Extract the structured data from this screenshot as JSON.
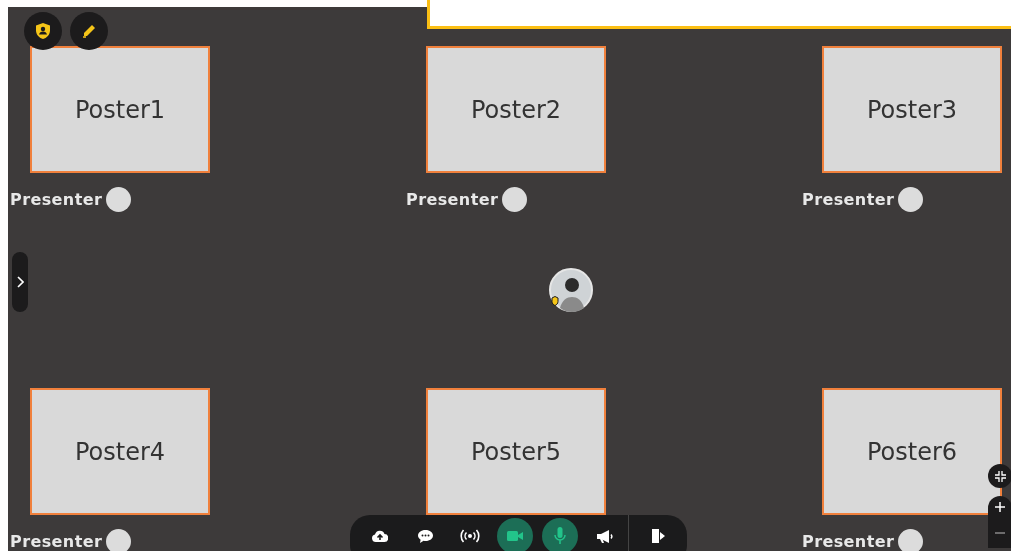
{
  "posters": [
    {
      "title": "Poster1",
      "presenter": "Presenter"
    },
    {
      "title": "Poster2",
      "presenter": "Presenter"
    },
    {
      "title": "Poster3",
      "presenter": "Presenter"
    },
    {
      "title": "Poster4",
      "presenter": "Presenter"
    },
    {
      "title": "Poster5"
    },
    {
      "title": "Poster6",
      "presenter": "Presenter"
    }
  ],
  "toolbar": [
    {
      "kind": "upload",
      "on": false
    },
    {
      "kind": "chat",
      "on": false
    },
    {
      "kind": "broadcast",
      "on": false
    },
    {
      "kind": "camera",
      "on": true
    },
    {
      "kind": "mic",
      "on": true
    },
    {
      "kind": "megaphone",
      "on": false
    },
    {
      "kind": "exit",
      "on": false
    }
  ]
}
